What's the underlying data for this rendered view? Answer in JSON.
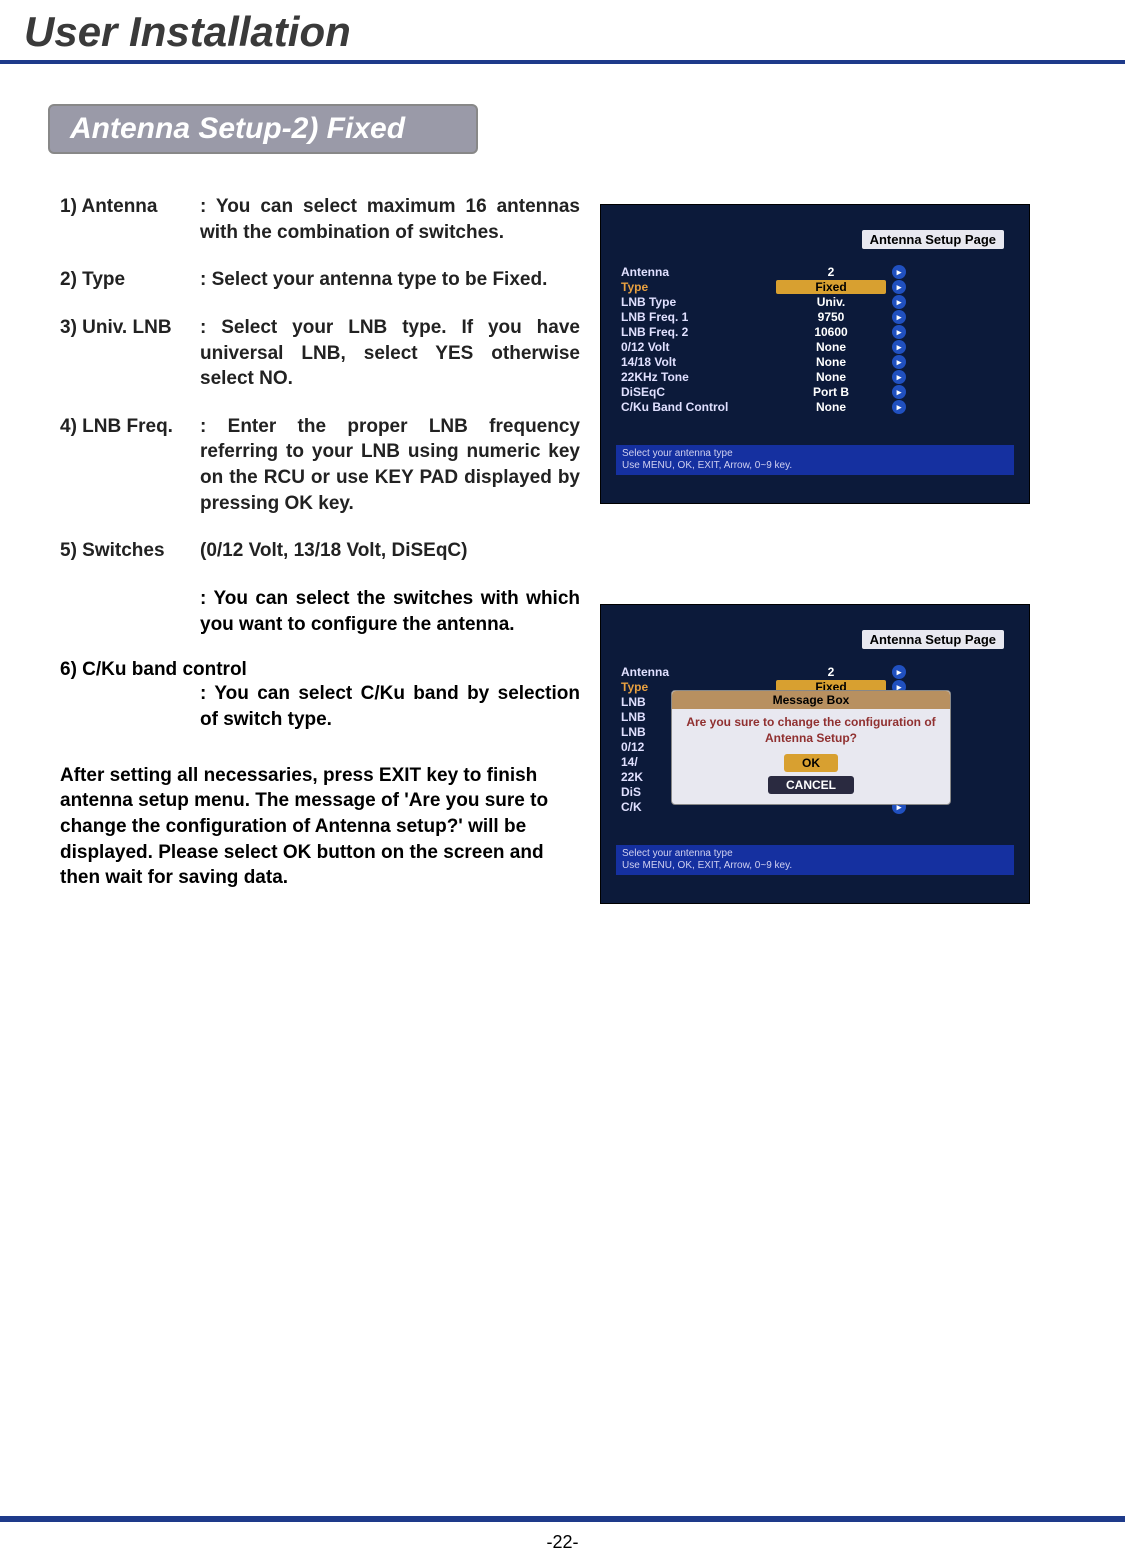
{
  "page_title": "User Installation",
  "section_title": "Antenna Setup-2) Fixed",
  "definitions": [
    {
      "label": "1) Antenna",
      "desc": ": You can select maximum 16 antennas with the combination of switches."
    },
    {
      "label": "2) Type",
      "desc": ": Select your antenna type to be Fixed."
    },
    {
      "label": "3)  Univ. LNB",
      "desc": ": Select your LNB type. If you have universal LNB, select YES otherwise select NO."
    },
    {
      "label": "4) LNB Freq.",
      "desc": ": Enter the proper LNB frequency referring to your LNB using numeric key on the RCU or use KEY PAD displayed by pressing OK key."
    }
  ],
  "switches": {
    "label": "5) Switches",
    "heading": "(0/12 Volt, 13/18 Volt, DiSEqC)",
    "desc": ": You can select the switches with which you want to configure the antenna."
  },
  "cku": {
    "label": "6) C/Ku band control",
    "desc": ": You can select C/Ku band by selection of switch type."
  },
  "after_text": "After setting all necessaries, press EXIT key to finish antenna setup menu.  The message of 'Are you sure to change the configuration of Antenna setup?' will be displayed.  Please select OK button on the screen and then wait for saving data.",
  "screenshot1": {
    "title": "Antenna Setup Page",
    "rows": [
      {
        "label": "Antenna",
        "value": "2",
        "hl": false,
        "orange": false
      },
      {
        "label": "Type",
        "value": "Fixed",
        "hl": true,
        "orange": true
      },
      {
        "label": "LNB Type",
        "value": "Univ.",
        "hl": false,
        "orange": false
      },
      {
        "label": "LNB Freq. 1",
        "value": "9750",
        "hl": false,
        "orange": false
      },
      {
        "label": "LNB Freq. 2",
        "value": "10600",
        "hl": false,
        "orange": false
      },
      {
        "label": "0/12 Volt",
        "value": "None",
        "hl": false,
        "orange": false
      },
      {
        "label": "14/18 Volt",
        "value": "None",
        "hl": false,
        "orange": false
      },
      {
        "label": "22KHz Tone",
        "value": "None",
        "hl": false,
        "orange": false
      },
      {
        "label": "DiSEqC",
        "value": "Port B",
        "hl": false,
        "orange": false
      },
      {
        "label": "C/Ku Band Control",
        "value": "None",
        "hl": false,
        "orange": false
      }
    ],
    "hint_line1": "Select your antenna type",
    "hint_line2": "Use MENU, OK, EXIT, Arrow, 0~9 key."
  },
  "screenshot2": {
    "title": "Antenna Setup Page",
    "rows": [
      {
        "label": "Antenna",
        "value": "2",
        "hl": false,
        "orange": false
      },
      {
        "label": "Type",
        "value": "Fixed",
        "hl": true,
        "orange": true
      },
      {
        "label": "LNB",
        "value": "",
        "hl": false,
        "orange": false
      },
      {
        "label": "LNB",
        "value": "",
        "hl": false,
        "orange": false
      },
      {
        "label": "LNB",
        "value": "",
        "hl": false,
        "orange": false
      },
      {
        "label": "0/12",
        "value": "",
        "hl": false,
        "orange": false
      },
      {
        "label": "14/",
        "value": "",
        "hl": false,
        "orange": false
      },
      {
        "label": "22K",
        "value": "",
        "hl": false,
        "orange": false
      },
      {
        "label": "DiS",
        "value": "",
        "hl": false,
        "orange": false
      },
      {
        "label": "C/K",
        "value": "",
        "hl": false,
        "orange": false
      }
    ],
    "msgbox_title": "Message Box",
    "msgbox_text": "Are you sure to change the configuration of Antenna Setup?",
    "ok": "OK",
    "cancel": "CANCEL",
    "hint_line1": "Select your antenna type",
    "hint_line2": "Use MENU, OK, EXIT, Arrow, 0~9 key."
  },
  "page_number": "-22-"
}
